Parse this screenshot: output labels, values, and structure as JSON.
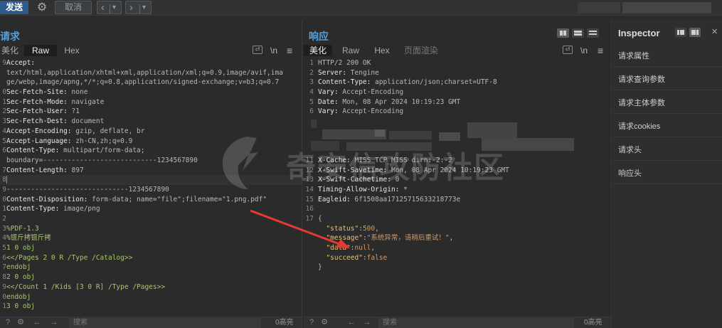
{
  "toolbar": {
    "send_label": "发送",
    "settings_icon": "gear-icon",
    "cancel_label": "取消",
    "back_icon": "‹",
    "back_dropdown_icon": "▾",
    "forward_icon": "›",
    "forward_dropdown_icon": "▾"
  },
  "request": {
    "title": "请求",
    "tabs": [
      "美化",
      "Raw",
      "Hex"
    ],
    "active_tab": "Raw",
    "tools": {
      "wrap_icon": "⏎",
      "newline": "\\n",
      "menu": "≡"
    },
    "lines": [
      {
        "n": "9",
        "key": "Accept",
        "val": ""
      },
      {
        "n": "",
        "key": "",
        "val": "text/html,application/xhtml+xml,application/xml;q=0.9,image/avif,ima"
      },
      {
        "n": "",
        "key": "",
        "val": "ge/webp,image/apng,*/*;q=0.8,application/signed-exchange;v=b3;q=0.7"
      },
      {
        "n": "0",
        "key": "Sec-Fetch-Site",
        "val": "none"
      },
      {
        "n": "1",
        "key": "Sec-Fetch-Mode",
        "val": "navigate"
      },
      {
        "n": "2",
        "key": "Sec-Fetch-User",
        "val": "?1"
      },
      {
        "n": "3",
        "key": "Sec-Fetch-Dest",
        "val": "document"
      },
      {
        "n": "4",
        "key": "Accept-Encoding",
        "val": "gzip, deflate, br"
      },
      {
        "n": "5",
        "key": "Accept-Language",
        "val": "zh-CN,zh;q=0.9"
      },
      {
        "n": "6",
        "key": "Content-Type",
        "val": "multipart/form-data;"
      },
      {
        "n": "",
        "key": "",
        "val": "boundary=----------------------------1234567890"
      },
      {
        "n": "7",
        "key": "Content-Length",
        "val": "897"
      },
      {
        "n": "8",
        "key": "",
        "val": "",
        "cursor": true
      },
      {
        "n": "9",
        "key": "",
        "val": "------------------------------1234567890"
      },
      {
        "n": "0",
        "key": "Content-Disposition",
        "val": "form-data; name=\"file\";filename=\"1.png.pdf\""
      },
      {
        "n": "1",
        "key": "Content-Type",
        "val": "image/png"
      },
      {
        "n": "2",
        "key": "",
        "val": ""
      },
      {
        "n": "3",
        "key": "",
        "val": "%PDF-1.3",
        "green": true
      },
      {
        "n": "4",
        "key": "",
        "val": "%锟斤拷锟斤拷",
        "green": true
      },
      {
        "n": "5",
        "key": "",
        "val": "1 0 obj",
        "green": true
      },
      {
        "n": "6",
        "key": "",
        "val": "<</Pages 2 0 R /Type /Catalog>>",
        "green": true
      },
      {
        "n": "7",
        "key": "",
        "val": "endobj",
        "green": true
      },
      {
        "n": "8",
        "key": "",
        "val": "2 0 obj",
        "green": true
      },
      {
        "n": "9",
        "key": "",
        "val": "<</Count 1 /Kids [3 0 R] /Type /Pages>>",
        "green": true
      },
      {
        "n": "0",
        "key": "",
        "val": "endobj",
        "green": true
      },
      {
        "n": "1",
        "key": "",
        "val": "3 0 obj",
        "green": true
      }
    ],
    "search_placeholder": "搜索",
    "match_count": "0高亮"
  },
  "response": {
    "title": "响应",
    "tabs": [
      "美化",
      "Raw",
      "Hex",
      "页面渲染"
    ],
    "active_tab": "美化",
    "tools": {
      "wrap_icon": "⏎",
      "newline": "\\n",
      "menu": "≡"
    },
    "header_lines": [
      {
        "n": "1",
        "key": "",
        "val": "HTTP/2 200 OK"
      },
      {
        "n": "2",
        "key": "Server",
        "val": "Tengine"
      },
      {
        "n": "3",
        "key": "Content-Type",
        "val": "application/json;charset=UTF-8"
      },
      {
        "n": "4",
        "key": "Vary",
        "val": "Accept-Encoding"
      },
      {
        "n": "5",
        "key": "Date",
        "val": "Mon, 08 Apr 2024 10:19:23 GMT"
      },
      {
        "n": "6",
        "key": "Vary",
        "val": "Accept-Encoding"
      }
    ],
    "tail_lines": [
      {
        "n": "11",
        "key": "X-Cache",
        "val": "MISS TCP_MISS dirn:-2:-2"
      },
      {
        "n": "12",
        "key": "X-Swift-Savetime",
        "val": "Mon, 08 Apr 2024 10:19:23 GMT"
      },
      {
        "n": "13",
        "key": "X-Swift-Cachetime",
        "val": "0"
      },
      {
        "n": "14",
        "key": "Timing-Allow-Origin",
        "val": "*"
      },
      {
        "n": "15",
        "key": "Eagleid",
        "val": "6f1508aa17125715633218773e"
      },
      {
        "n": "16",
        "key": "",
        "val": ""
      },
      {
        "n": "17",
        "key": "",
        "val": "{"
      }
    ],
    "json_body": [
      {
        "key": "\"status\"",
        "val": "500",
        "type": "num",
        "comma": ","
      },
      {
        "key": "\"message\"",
        "val": "\"系统异常，请稍后重试！\"",
        "type": "str",
        "comma": ","
      },
      {
        "key": "\"data\"",
        "val": "null",
        "type": "num",
        "comma": ","
      },
      {
        "key": "\"succeed\"",
        "val": "false",
        "type": "num",
        "comma": ""
      }
    ],
    "json_close": "}",
    "search_placeholder": "搜索",
    "match_count": "0高亮"
  },
  "inspector": {
    "title": "Inspector",
    "items": [
      "请求属性",
      "请求查询参数",
      "请求主体参数",
      "请求cookies",
      "请求头",
      "响应头"
    ]
  },
  "watermark": {
    "text": "奇安信攻防社区"
  },
  "colors": {
    "accent": "#5a9fd6",
    "send_button": "#2e5a8c",
    "arrow": "#e53935",
    "json_key": "#e6c07b",
    "json_value": "#d19a66",
    "pdf_body": "#a8c76e"
  }
}
